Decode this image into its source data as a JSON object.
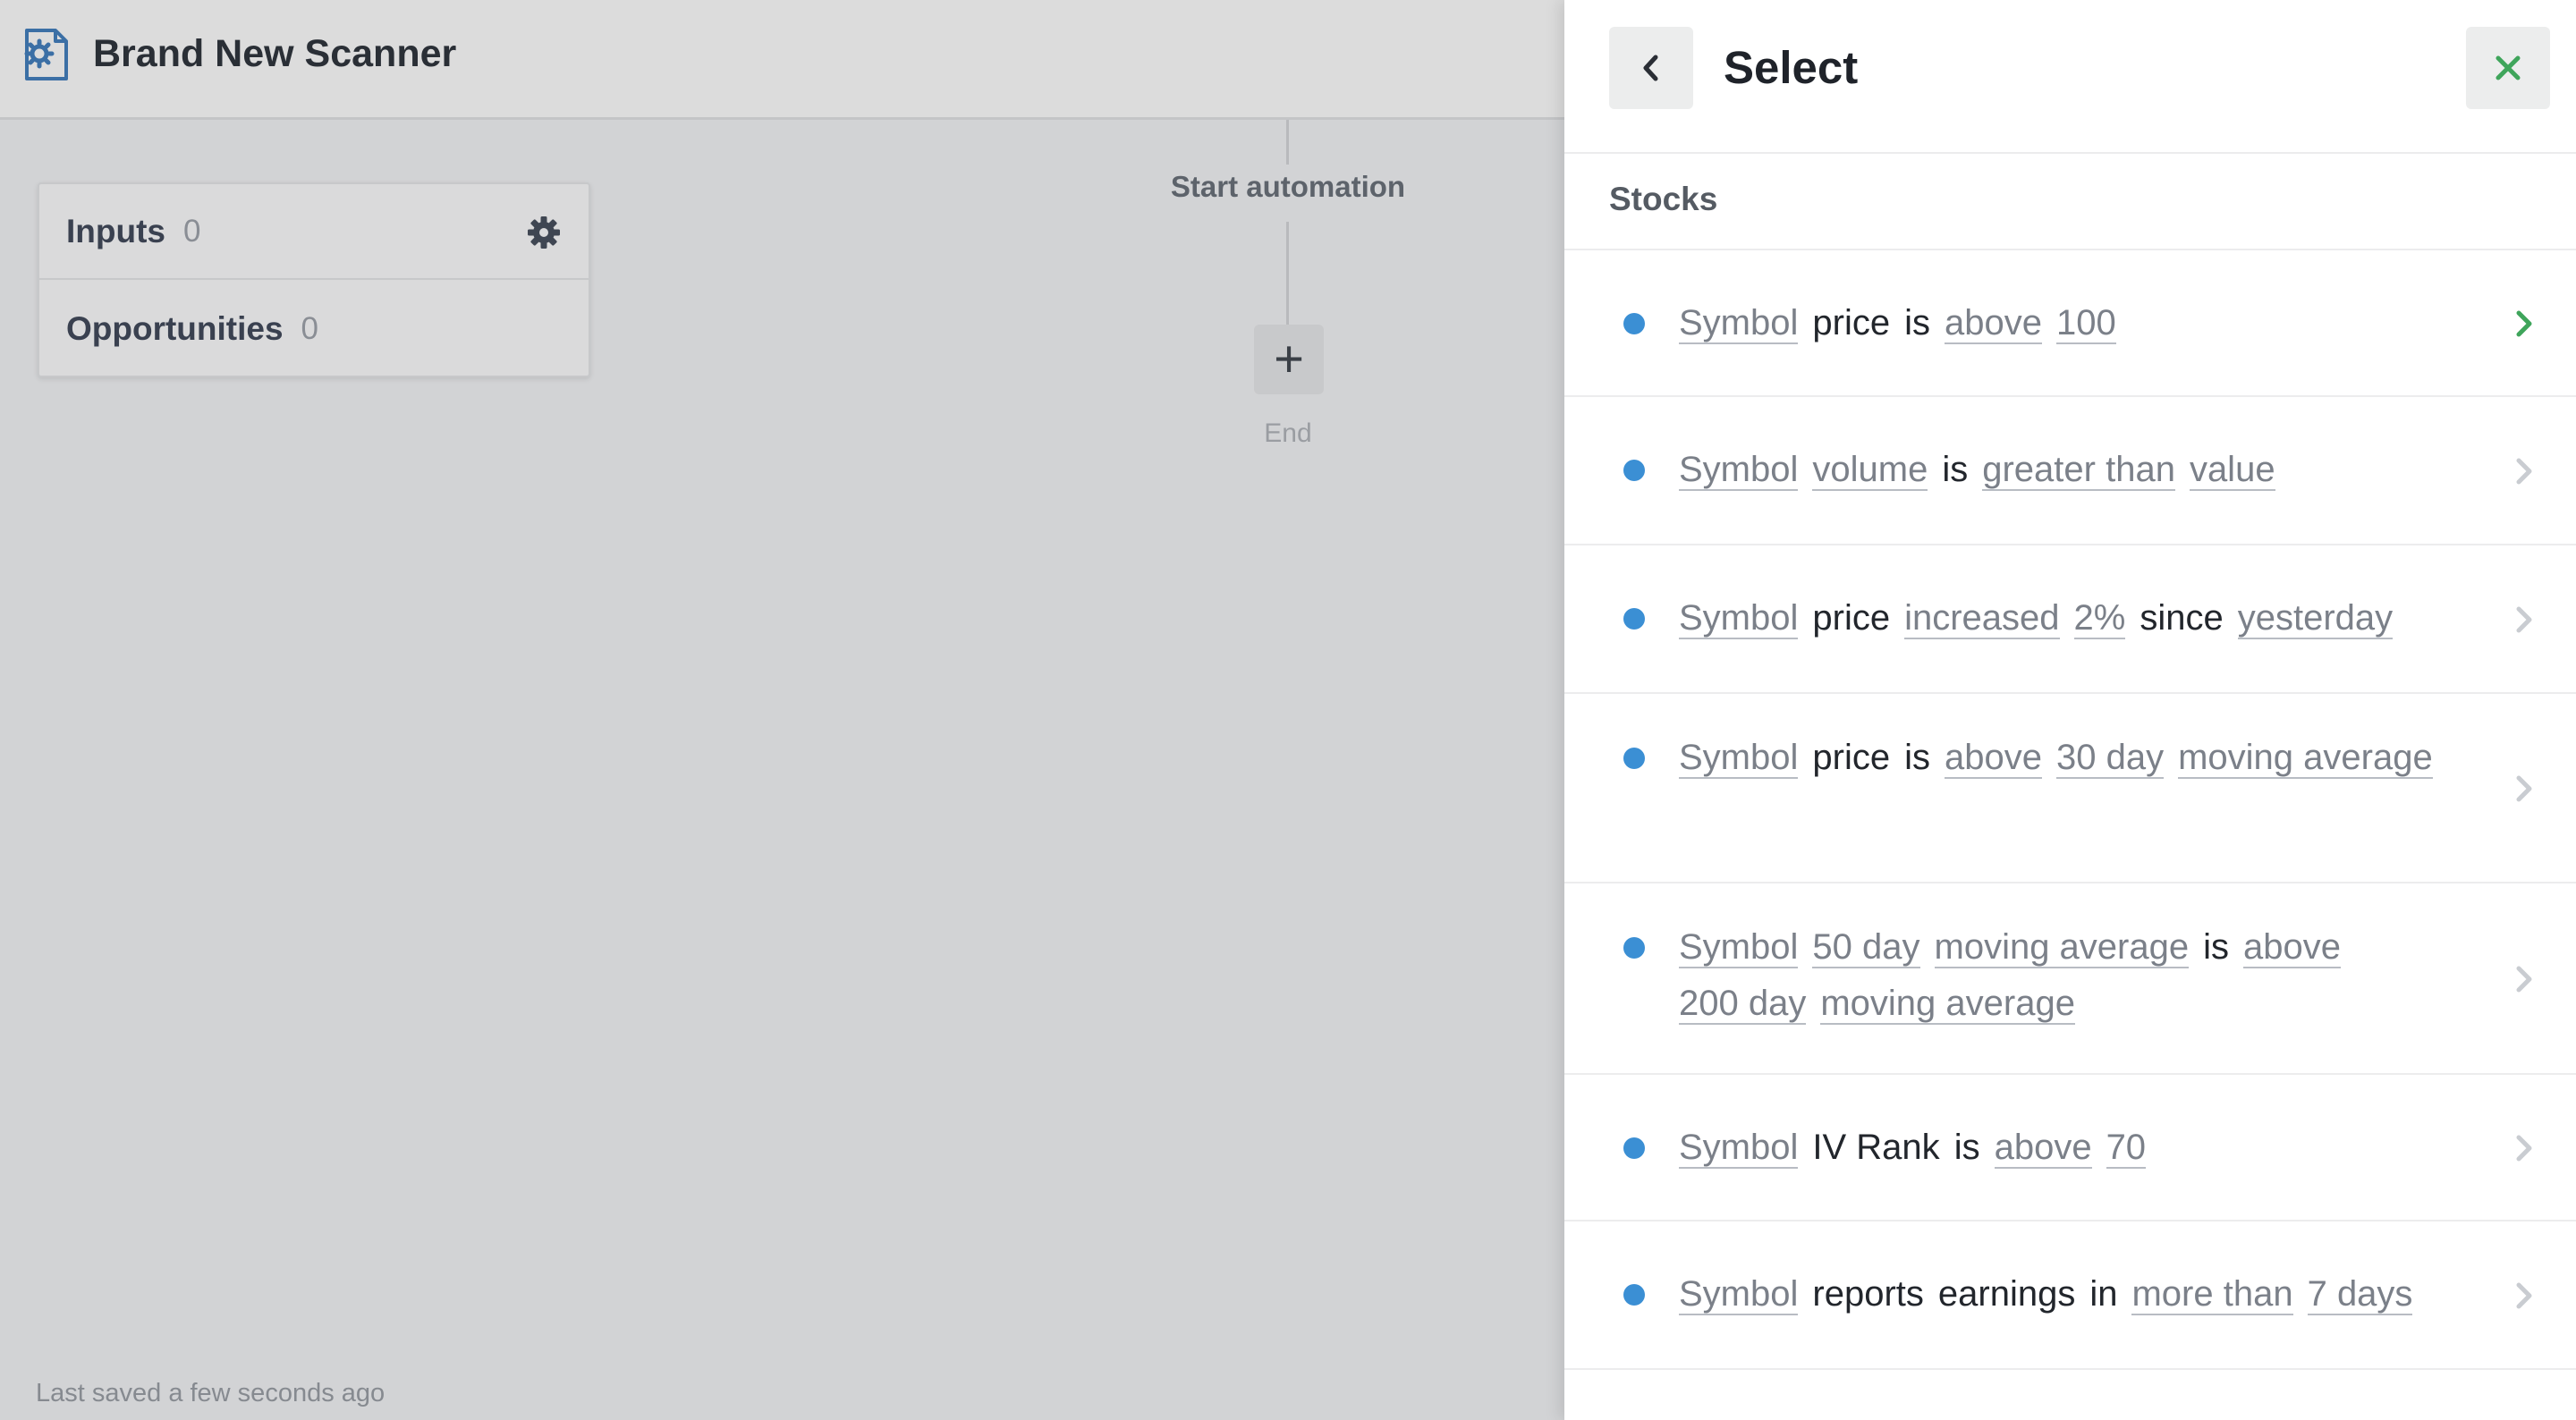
{
  "app": {
    "title": "Brand New Scanner",
    "saved_text": "Last saved a few seconds ago"
  },
  "io": {
    "inputs_label": "Inputs",
    "inputs_count": "0",
    "opportunities_label": "Opportunities",
    "opportunities_count": "0"
  },
  "flow": {
    "start_label": "Start automation",
    "add_symbol": "+",
    "end_label": "End"
  },
  "panel": {
    "title": "Select",
    "section": "Stocks",
    "accent_color": "#3fa55b",
    "dot_color": "#3b8fd4"
  },
  "items": [
    {
      "parts": [
        {
          "t": "Symbol",
          "v": true
        },
        {
          "t": "price",
          "v": false
        },
        {
          "t": "is",
          "v": false
        },
        {
          "t": "above",
          "v": true
        },
        {
          "t": "100",
          "v": true
        }
      ],
      "active": true
    },
    {
      "parts": [
        {
          "t": "Symbol",
          "v": true
        },
        {
          "t": "volume",
          "v": true
        },
        {
          "t": "is",
          "v": false
        },
        {
          "t": "greater than",
          "v": true
        },
        {
          "t": "value",
          "v": true
        }
      ],
      "active": false
    },
    {
      "parts": [
        {
          "t": "Symbol",
          "v": true
        },
        {
          "t": "price",
          "v": false
        },
        {
          "t": "increased",
          "v": true
        },
        {
          "t": "2%",
          "v": true
        },
        {
          "t": "since",
          "v": false
        },
        {
          "t": "yesterday",
          "v": true
        }
      ],
      "active": false
    },
    {
      "parts": [
        {
          "t": "Symbol",
          "v": true
        },
        {
          "t": "price",
          "v": false
        },
        {
          "t": "is",
          "v": false
        },
        {
          "t": "above",
          "v": true
        },
        {
          "t": "30 day",
          "v": true
        },
        {
          "t": "moving average",
          "v": true
        }
      ],
      "active": false
    },
    {
      "parts": [
        {
          "t": "Symbol",
          "v": true
        },
        {
          "t": "50 day",
          "v": true
        },
        {
          "t": "moving average",
          "v": true
        },
        {
          "t": "is",
          "v": false
        },
        {
          "t": "above",
          "v": true
        },
        {
          "t": "200 day",
          "v": true
        },
        {
          "t": "moving average",
          "v": true
        }
      ],
      "active": false
    },
    {
      "parts": [
        {
          "t": "Symbol",
          "v": true
        },
        {
          "t": "IV Rank",
          "v": false
        },
        {
          "t": "is",
          "v": false
        },
        {
          "t": "above",
          "v": true
        },
        {
          "t": "70",
          "v": true
        }
      ],
      "active": false
    },
    {
      "parts": [
        {
          "t": "Symbol",
          "v": true
        },
        {
          "t": "reports",
          "v": false
        },
        {
          "t": "earnings",
          "v": false
        },
        {
          "t": "in",
          "v": false
        },
        {
          "t": "more than",
          "v": true
        },
        {
          "t": "7 days",
          "v": true
        }
      ],
      "active": false
    }
  ]
}
